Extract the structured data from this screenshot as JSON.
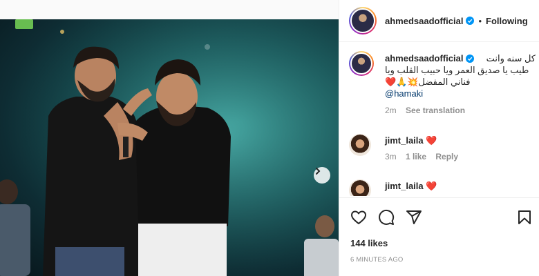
{
  "post": {
    "username": "ahmedsaadofficial",
    "dot": "•",
    "follow_label": "Following",
    "caption_line1": "كل سنه وانت",
    "caption_line2": "طيب يا صديق العمر ويا حبيب القلب ويا",
    "caption_line3": "فناني المفضل💥🙏❤️",
    "caption_mention": "@hamaki",
    "caption_time": "2m",
    "see_translation": "See translation"
  },
  "comments": [
    {
      "username": "jimt_laila",
      "heart": "❤️",
      "time": "3m",
      "likes": "1 like",
      "reply": "Reply"
    },
    {
      "username": "jimt_laila",
      "heart": "❤️"
    }
  ],
  "footer": {
    "likes": "144 likes",
    "posted": "6 MINUTES AGO"
  },
  "icons": [
    "heart-icon",
    "comment-icon",
    "share-icon",
    "bookmark-icon",
    "verified-icon",
    "chevron-right-icon"
  ],
  "colors": {
    "accent": "#0095f6",
    "verified": "#0095f6",
    "heart": "#ed4956",
    "muted": "#8e8e8e"
  }
}
